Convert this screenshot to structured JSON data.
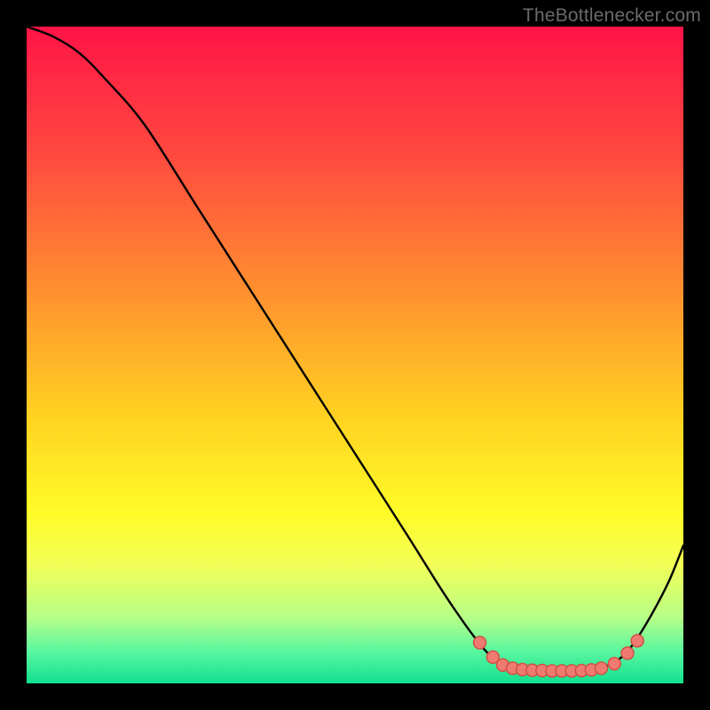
{
  "attribution": "TheBottlenecker.com",
  "chart_data": {
    "type": "line",
    "title": "",
    "xlabel": "",
    "ylabel": "",
    "xlim": [
      0,
      100
    ],
    "ylim": [
      0,
      100
    ],
    "grid": false,
    "background": {
      "type": "vertical-gradient",
      "stops": [
        {
          "pos": 0.0,
          "color": "#ff1447"
        },
        {
          "pos": 0.2,
          "color": "#ff4b3f"
        },
        {
          "pos": 0.4,
          "color": "#ff8f30"
        },
        {
          "pos": 0.6,
          "color": "#ffd421"
        },
        {
          "pos": 0.74,
          "color": "#fffb28"
        },
        {
          "pos": 0.82,
          "color": "#f2ff58"
        },
        {
          "pos": 0.9,
          "color": "#b6ff87"
        },
        {
          "pos": 0.95,
          "color": "#5cf7a0"
        },
        {
          "pos": 1.0,
          "color": "#12e08f"
        }
      ]
    },
    "series": [
      {
        "name": "curve",
        "stroke": "#000000",
        "stroke_width": 2.4,
        "x": [
          0,
          4,
          8,
          12,
          18,
          26,
          34,
          42,
          50,
          58,
          64,
          69,
          72,
          74,
          76,
          78,
          80,
          82,
          84,
          86,
          88,
          90,
          92,
          94,
          96,
          98,
          100
        ],
        "y": [
          100,
          98.5,
          96,
          92,
          85,
          72.5,
          60,
          47.5,
          35,
          22.5,
          13,
          6,
          3,
          2.3,
          2,
          1.9,
          1.9,
          1.9,
          1.9,
          2,
          2.5,
          3.5,
          5.5,
          8.5,
          12,
          16,
          21
        ]
      }
    ],
    "markers": {
      "shape": "circle",
      "fill": "#ee7a70",
      "stroke": "#d24d42",
      "stroke_width": 1.4,
      "radius": 7,
      "points": [
        {
          "x": 69,
          "y": 6.2
        },
        {
          "x": 71,
          "y": 4.0
        },
        {
          "x": 72.5,
          "y": 2.8
        },
        {
          "x": 74,
          "y": 2.3
        },
        {
          "x": 75.5,
          "y": 2.1
        },
        {
          "x": 77,
          "y": 2.0
        },
        {
          "x": 78.5,
          "y": 1.95
        },
        {
          "x": 80,
          "y": 1.9
        },
        {
          "x": 81.5,
          "y": 1.9
        },
        {
          "x": 83,
          "y": 1.9
        },
        {
          "x": 84.5,
          "y": 1.95
        },
        {
          "x": 86,
          "y": 2.05
        },
        {
          "x": 87.5,
          "y": 2.3
        },
        {
          "x": 89.5,
          "y": 3.0
        },
        {
          "x": 91.5,
          "y": 4.6
        },
        {
          "x": 93,
          "y": 6.5
        }
      ]
    }
  }
}
